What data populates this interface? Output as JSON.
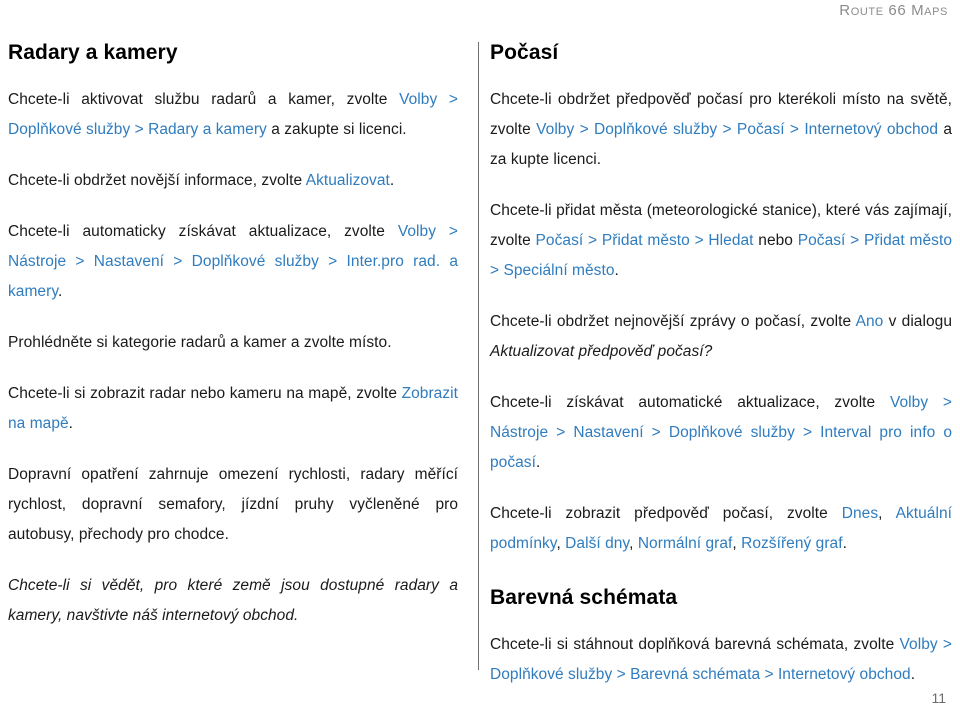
{
  "header": {
    "running_title": "Route 66 Maps"
  },
  "accent_colors": {
    "link_blue": "#2f7cbe",
    "body_text": "#1a1a1a",
    "header_gray": "#8c8c8c",
    "divider_gray": "#6f6f6f"
  },
  "left_column": {
    "title": "Radary a kamery",
    "paragraphs": [
      {
        "id": "aktivovat-sluzbu",
        "runs": [
          {
            "text": "Chcete-li aktivovat službu radarů a kamer, zvolte ",
            "style": "plain"
          },
          {
            "text": "Volby > Doplňkové služby > Radary a kamery",
            "style": "link"
          },
          {
            "text": " a zakupte si licenci.",
            "style": "plain"
          }
        ]
      },
      {
        "id": "novejsi-informace",
        "runs": [
          {
            "text": "Chcete-li obdržet novější informace, zvolte ",
            "style": "plain"
          },
          {
            "text": "Aktualizovat",
            "style": "link"
          },
          {
            "text": ".",
            "style": "plain"
          }
        ]
      },
      {
        "id": "automaticke-aktualizace",
        "runs": [
          {
            "text": "Chcete-li automaticky získávat aktualizace, zvolte ",
            "style": "plain"
          },
          {
            "text": "Volby > Nástroje > Nastavení > Doplňkové služby > Inter.pro rad. a kamery",
            "style": "link"
          },
          {
            "text": ".",
            "style": "plain"
          }
        ]
      },
      {
        "id": "kategorie-radaru",
        "runs": [
          {
            "text": "Prohlédněte si kategorie radarů a kamer a zvolte místo.",
            "style": "plain"
          }
        ]
      },
      {
        "id": "zobrazit-na-mape",
        "runs": [
          {
            "text": "Chcete-li si zobrazit radar nebo kameru na mapě, zvolte ",
            "style": "plain"
          },
          {
            "text": "Zobrazit na mapě",
            "style": "link"
          },
          {
            "text": ".",
            "style": "plain"
          }
        ]
      },
      {
        "id": "dopravni-opatreni",
        "runs": [
          {
            "text": "Dopravní opatření zahrnuje omezení rychlosti, radary měřící rychlost, dopravní semafory, jízdní pruhy vyčleněné pro autobusy, přechody pro chodce.",
            "style": "plain"
          }
        ]
      },
      {
        "id": "dostupne-zeme",
        "italic": true,
        "runs": [
          {
            "text": "Chcete-li si vědět, pro které země jsou dostupné radary a kamery, navštivte náš internetový obchod.",
            "style": "plain"
          }
        ]
      }
    ]
  },
  "right_column": {
    "title": "Počasí",
    "paragraphs": [
      {
        "id": "predpoved-pocasi",
        "runs": [
          {
            "text": "Chcete-li obdržet předpověď počasí pro kterékoli místo na světě, zvolte ",
            "style": "plain"
          },
          {
            "text": "Volby > Doplňkové služby > Počasí > Internetový obchod",
            "style": "link"
          },
          {
            "text": " a za kupte licenci.",
            "style": "plain"
          }
        ]
      },
      {
        "id": "pridat-mesta",
        "runs": [
          {
            "text": "Chcete-li přidat města (meteorologické stanice), které vás zajímají, zvolte ",
            "style": "plain"
          },
          {
            "text": "Počasí > Přidat město > Hledat",
            "style": "link"
          },
          {
            "text": " nebo ",
            "style": "plain"
          },
          {
            "text": "Počasí > Přidat město > Speciální město",
            "style": "link"
          },
          {
            "text": ".",
            "style": "plain"
          }
        ]
      },
      {
        "id": "nejnovejsi-zpravy",
        "runs": [
          {
            "text": "Chcete-li obdržet nejnovější zprávy o počasí, zvolte ",
            "style": "plain"
          },
          {
            "text": "Ano",
            "style": "link"
          },
          {
            "text": " v dialogu ",
            "style": "plain"
          },
          {
            "text": "Aktualizovat předpověď počasí?",
            "style": "italic"
          }
        ]
      },
      {
        "id": "automaticke-aktualizace-pocasi",
        "runs": [
          {
            "text": "Chcete-li získávat automatické aktualizace, zvolte ",
            "style": "plain"
          },
          {
            "text": "Volby > Nástroje > Nastavení > Doplňkové služby > Interval pro info o počasí",
            "style": "link"
          },
          {
            "text": ".",
            "style": "plain"
          }
        ]
      },
      {
        "id": "zobrazit-predpoved",
        "runs": [
          {
            "text": "Chcete-li zobrazit předpověď počasí, zvolte ",
            "style": "plain"
          },
          {
            "text": "Dnes",
            "style": "link"
          },
          {
            "text": ", ",
            "style": "plain"
          },
          {
            "text": "Aktuální podmínky",
            "style": "link"
          },
          {
            "text": ", ",
            "style": "plain"
          },
          {
            "text": "Další dny",
            "style": "link"
          },
          {
            "text": ", ",
            "style": "plain"
          },
          {
            "text": "Normální graf",
            "style": "link"
          },
          {
            "text": ", ",
            "style": "plain"
          },
          {
            "text": "Rozšířený graf",
            "style": "link"
          },
          {
            "text": ".",
            "style": "plain"
          }
        ]
      }
    ],
    "second_title": "Barevná schémata",
    "second_paragraphs": [
      {
        "id": "barevna-schemata-stazeni",
        "runs": [
          {
            "text": "Chcete-li si stáhnout doplňková barevná schémata, zvolte ",
            "style": "plain"
          },
          {
            "text": "Volby > Doplňkové služby > Barevná schémata > Internetový obchod",
            "style": "link"
          },
          {
            "text": ".",
            "style": "plain"
          }
        ]
      }
    ]
  },
  "footer": {
    "page_number": "11"
  }
}
